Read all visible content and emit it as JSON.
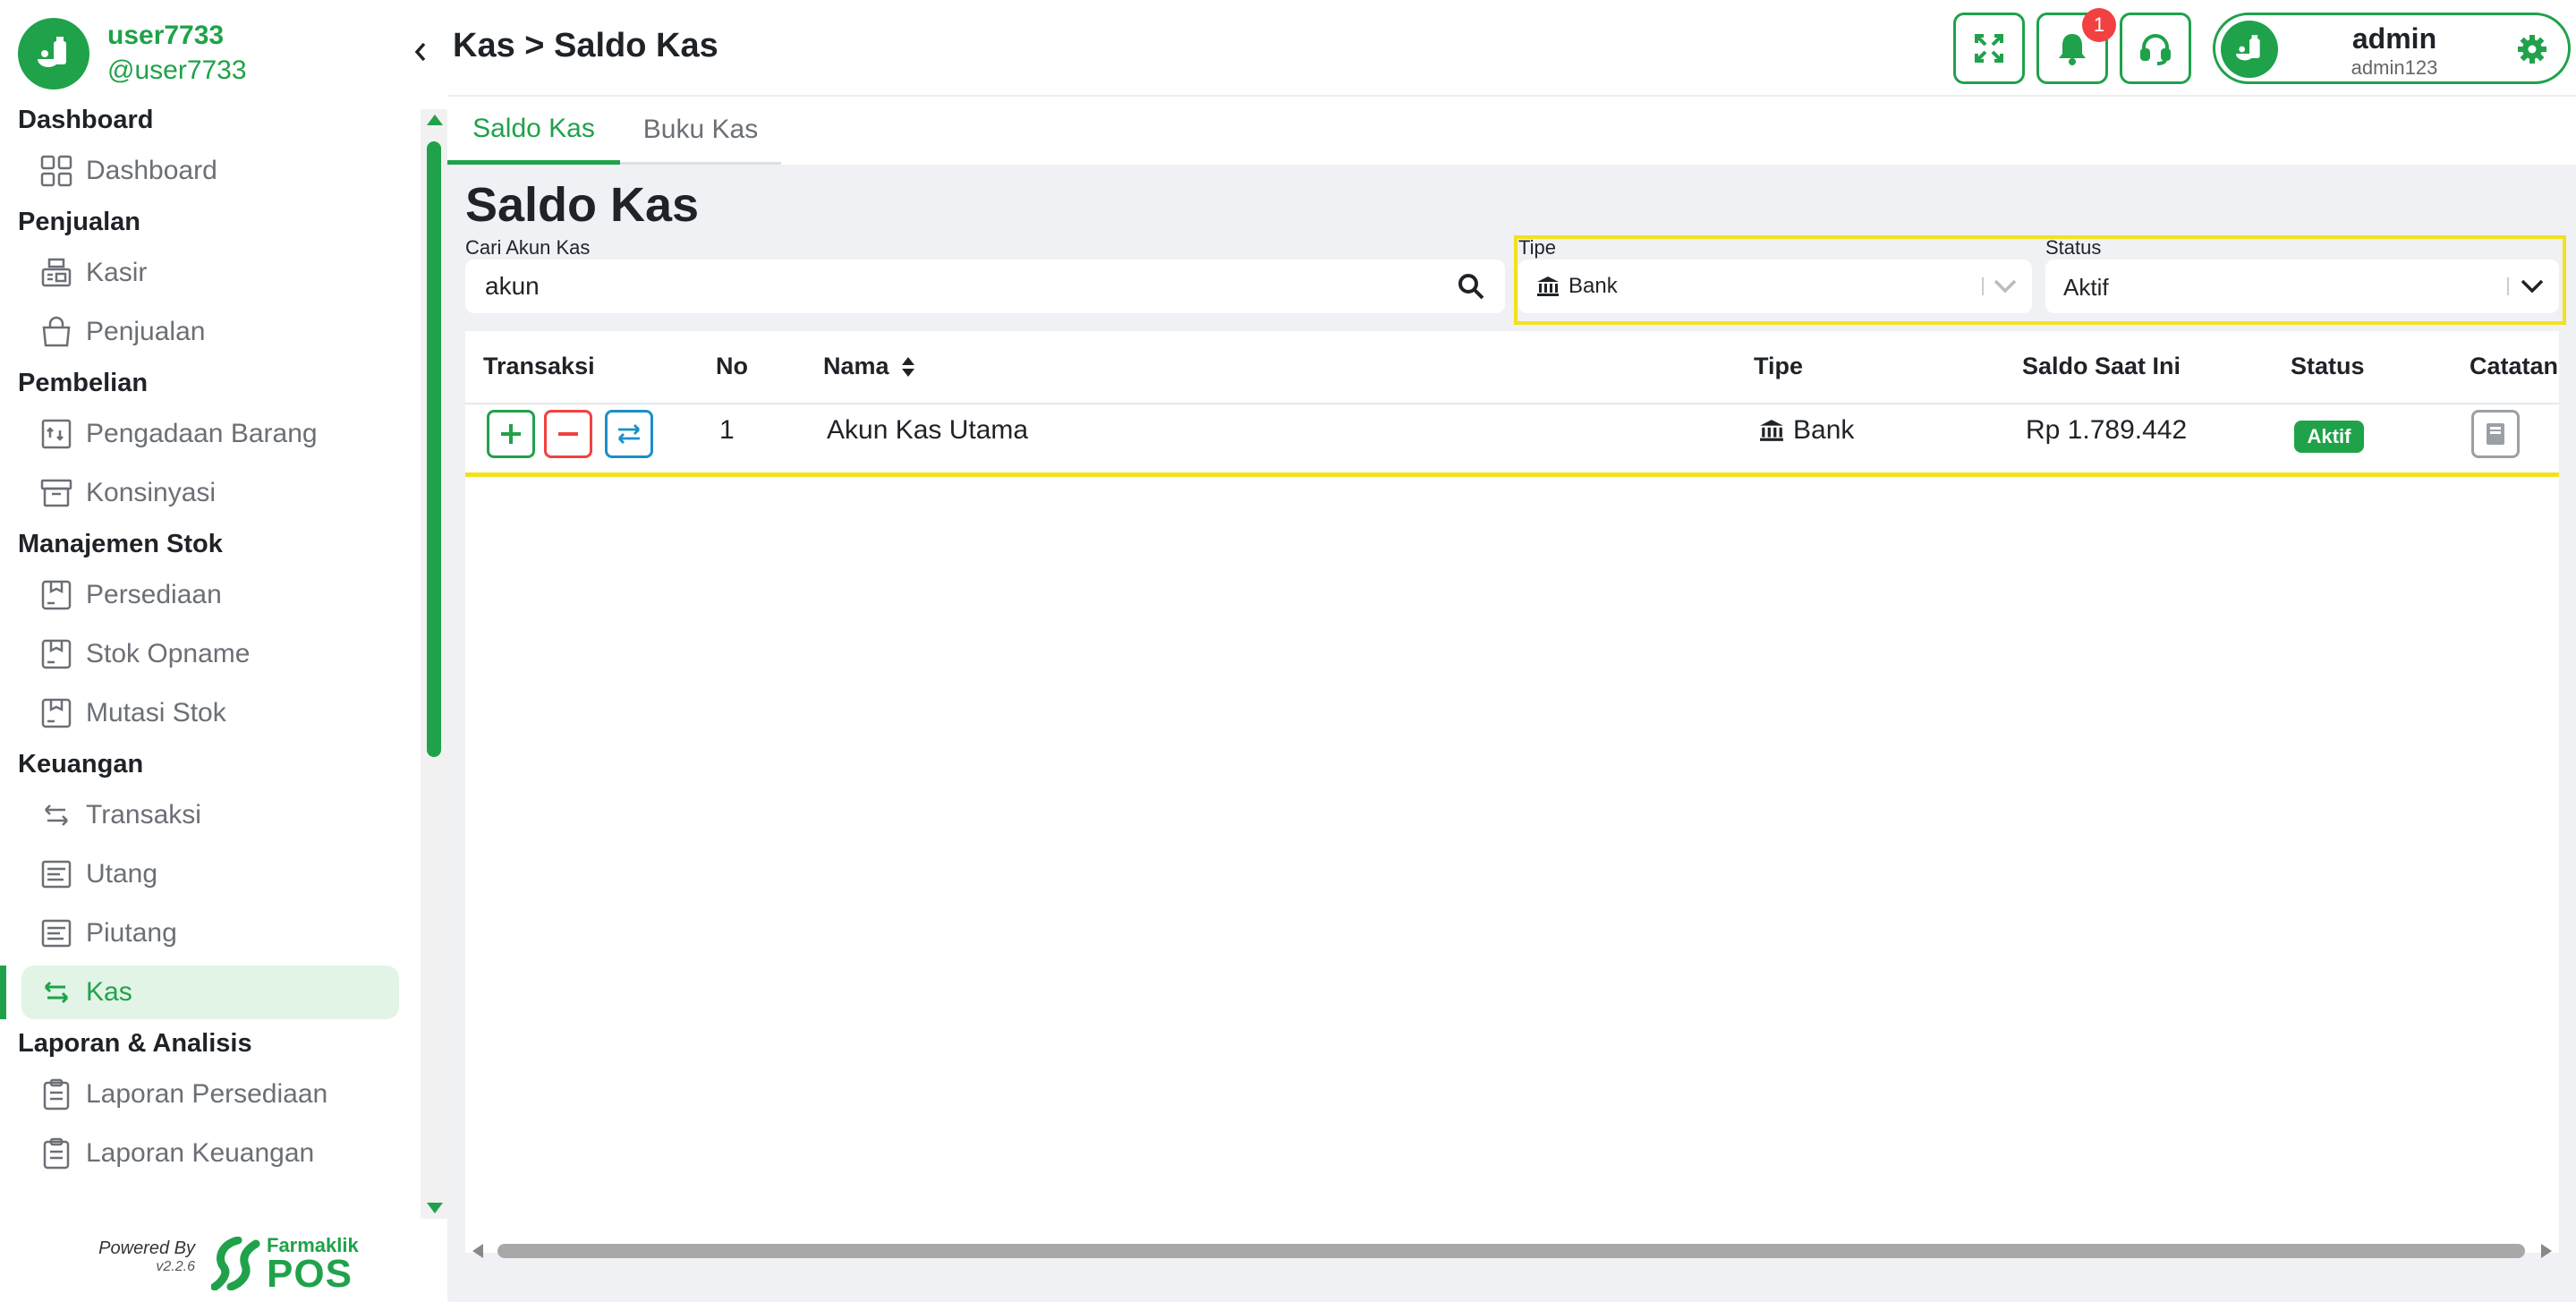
{
  "user": {
    "name": "user7733",
    "handle": "@user7733"
  },
  "sidebar": {
    "sections": [
      {
        "title": "Dashboard",
        "items": [
          {
            "label": "Dashboard",
            "icon": "dashboard-grid-icon"
          }
        ]
      },
      {
        "title": "Penjualan",
        "items": [
          {
            "label": "Kasir",
            "icon": "cash-register-icon"
          },
          {
            "label": "Penjualan",
            "icon": "shopping-bag-icon"
          }
        ]
      },
      {
        "title": "Pembelian",
        "items": [
          {
            "label": "Pengadaan Barang",
            "icon": "procurement-icon"
          },
          {
            "label": "Konsinyasi",
            "icon": "archive-box-icon"
          }
        ]
      },
      {
        "title": "Manajemen Stok",
        "items": [
          {
            "label": "Persediaan",
            "icon": "inventory-box-icon"
          },
          {
            "label": "Stok Opname",
            "icon": "stock-opname-icon"
          },
          {
            "label": "Mutasi Stok",
            "icon": "stock-mutation-icon"
          }
        ]
      },
      {
        "title": "Keuangan",
        "items": [
          {
            "label": "Transaksi",
            "icon": "transfer-arrows-icon"
          },
          {
            "label": "Utang",
            "icon": "receipt-icon"
          },
          {
            "label": "Piutang",
            "icon": "receipt-icon"
          },
          {
            "label": "Kas",
            "icon": "cash-transfer-icon",
            "active": true
          }
        ]
      },
      {
        "title": "Laporan & Analisis",
        "items": [
          {
            "label": "Laporan Persediaan",
            "icon": "clipboard-icon"
          },
          {
            "label": "Laporan Keuangan",
            "icon": "clipboard-icon"
          }
        ]
      }
    ]
  },
  "footer": {
    "powered_by": "Powered By",
    "version": "v2.2.6",
    "brand_top": "Farmaklik",
    "brand_bottom": "POS"
  },
  "header": {
    "breadcrumb": "Kas > Saldo Kas",
    "notification_count": "1",
    "profile": {
      "name": "admin",
      "handle": "admin123"
    }
  },
  "tabs": [
    {
      "label": "Saldo Kas",
      "active": true
    },
    {
      "label": "Buku Kas",
      "active": false
    }
  ],
  "page": {
    "title": "Saldo Kas",
    "search": {
      "label": "Cari Akun Kas",
      "value": "akun"
    },
    "filters": {
      "type": {
        "label": "Tipe",
        "value": "Bank"
      },
      "status": {
        "label": "Status",
        "value": "Aktif"
      }
    }
  },
  "table": {
    "columns": [
      "Transaksi",
      "No",
      "Nama",
      "Tipe",
      "Saldo Saat Ini",
      "Status",
      "Catatan"
    ],
    "rows": [
      {
        "no": "1",
        "nama": "Akun Kas Utama",
        "tipe": "Bank",
        "saldo": "Rp 1.789.442",
        "status": "Aktif"
      }
    ]
  },
  "colors": {
    "brand": "#1fa24a",
    "danger": "#f24141",
    "info": "#1b8fc7",
    "highlight": "#f2e21e"
  }
}
